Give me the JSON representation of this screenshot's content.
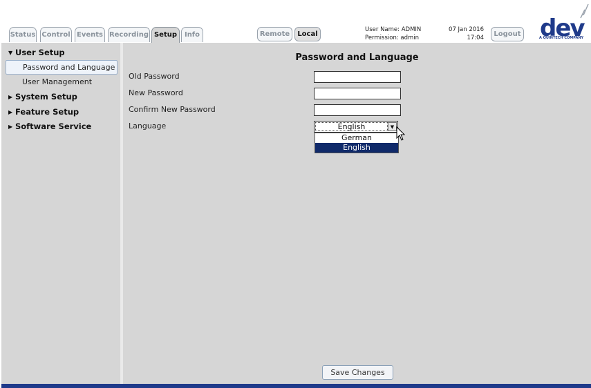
{
  "header": {
    "tabs": [
      {
        "label": "Status",
        "active": false
      },
      {
        "label": "Control",
        "active": false
      },
      {
        "label": "Events",
        "active": false
      },
      {
        "label": "Recording",
        "active": false
      },
      {
        "label": "Setup",
        "active": true
      },
      {
        "label": "Info",
        "active": false
      }
    ],
    "mode_buttons": [
      {
        "label": "Remote",
        "active": false
      },
      {
        "label": "Local",
        "active": true
      }
    ],
    "user_name": "User Name: ADMIN",
    "permission": "Permission: admin",
    "date": "07 Jan 2016",
    "time": "17:04",
    "logout_label": "Logout",
    "logo": {
      "text": "dev",
      "tagline": "A QUINTECH COMPANY",
      "color": "#1f3a8a"
    }
  },
  "sidebar": {
    "groups": [
      {
        "label": "User Setup",
        "expanded": true,
        "icon": "triangle-down-icon",
        "items": [
          {
            "label": "Password and Language",
            "selected": true
          },
          {
            "label": "User Management",
            "selected": false
          }
        ]
      },
      {
        "label": "System Setup",
        "expanded": false,
        "icon": "triangle-right-icon"
      },
      {
        "label": "Feature Setup",
        "expanded": false,
        "icon": "triangle-right-icon"
      },
      {
        "label": "Software Service",
        "expanded": false,
        "icon": "triangle-right-icon"
      }
    ]
  },
  "main": {
    "title": "Password and Language",
    "fields": {
      "old_password": {
        "label": "Old Password",
        "value": ""
      },
      "new_password": {
        "label": "New Password",
        "value": ""
      },
      "confirm_password": {
        "label": "Confirm New Password",
        "value": ""
      },
      "language": {
        "label": "Language",
        "value": "English",
        "options": [
          "German",
          "English"
        ],
        "highlighted": "English"
      }
    },
    "save_label": "Save Changes"
  },
  "colors": {
    "accent": "#1f3a8a",
    "panel": "#d6d6d6",
    "highlight": "#102a6a"
  }
}
